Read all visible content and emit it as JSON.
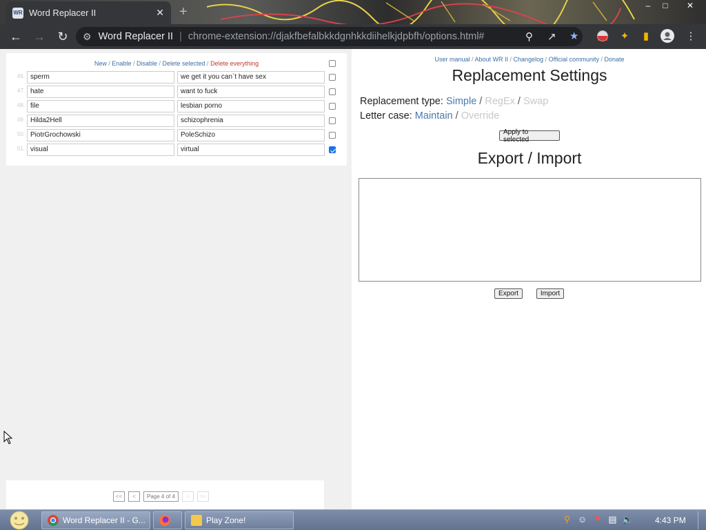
{
  "window": {
    "tab_title": "Word Replacer II",
    "favicon_text": "WR",
    "new_tab": "+",
    "close_glyph": "✕"
  },
  "toolbar": {
    "site_name": "Word Replacer II",
    "separator": "|",
    "url": "chrome-extension://djakfbefalbkkdgnhkkdiihelkjdpbfh/options.html#"
  },
  "list": {
    "actions": [
      {
        "label": "New",
        "style": "link"
      },
      {
        "label": "Enable",
        "style": "link"
      },
      {
        "label": "Disable",
        "style": "link"
      },
      {
        "label": "Delete selected",
        "style": "link"
      },
      {
        "label": "Delete everything",
        "style": "danger"
      }
    ],
    "select_all_checked": false,
    "rows": [
      {
        "num": "46.",
        "word": "sperm",
        "replacement": "we get it you can`t have sex",
        "checked": false
      },
      {
        "num": "47.",
        "word": "hate",
        "replacement": "want to fuck",
        "checked": false
      },
      {
        "num": "48.",
        "word": "file",
        "replacement": "lesbian porno",
        "checked": false
      },
      {
        "num": "49.",
        "word": "Hilda2Hell",
        "replacement": "schizophrenia",
        "checked": false
      },
      {
        "num": "50.",
        "word": "PiotrGrochowski",
        "replacement": "PoleSchizo",
        "checked": false
      },
      {
        "num": "51.",
        "word": "visual",
        "replacement": "virtual",
        "checked": true
      }
    ]
  },
  "pager": {
    "first": "<<",
    "prev": "<",
    "label": "Page 4 of 4",
    "next": ">",
    "last": ">>"
  },
  "right": {
    "links": [
      "User manual",
      "About WR II",
      "Changelog",
      "Official community",
      "Donate"
    ],
    "settings_title": "Replacement Settings",
    "type_label": "Replacement type:",
    "type_options": [
      {
        "label": "Simple",
        "active": true
      },
      {
        "label": "RegEx",
        "active": false
      },
      {
        "label": "Swap",
        "active": false
      }
    ],
    "case_label": "Letter case:",
    "case_options": [
      {
        "label": "Maintain",
        "active": true
      },
      {
        "label": "Override",
        "active": false
      }
    ],
    "apply_label": "Apply to selected",
    "export_title": "Export / Import",
    "textarea_value": "",
    "export_label": "Export",
    "import_label": "Import"
  },
  "taskbar": {
    "tasks": [
      {
        "label": "Word Replacer II - G...",
        "icon": "chrome-icon",
        "active": true
      },
      {
        "label": "",
        "icon": "firefox-icon",
        "active": false
      },
      {
        "label": "Play Zone!",
        "icon": "folder-icon",
        "active": false
      }
    ],
    "clock": "4:43 PM"
  },
  "colors": {
    "link": "#3b6ea5",
    "danger": "#c0392b",
    "option_active": "#4a78b0",
    "option_inactive": "#c8c8c8",
    "checkbox_checked": "#1a73e8"
  }
}
